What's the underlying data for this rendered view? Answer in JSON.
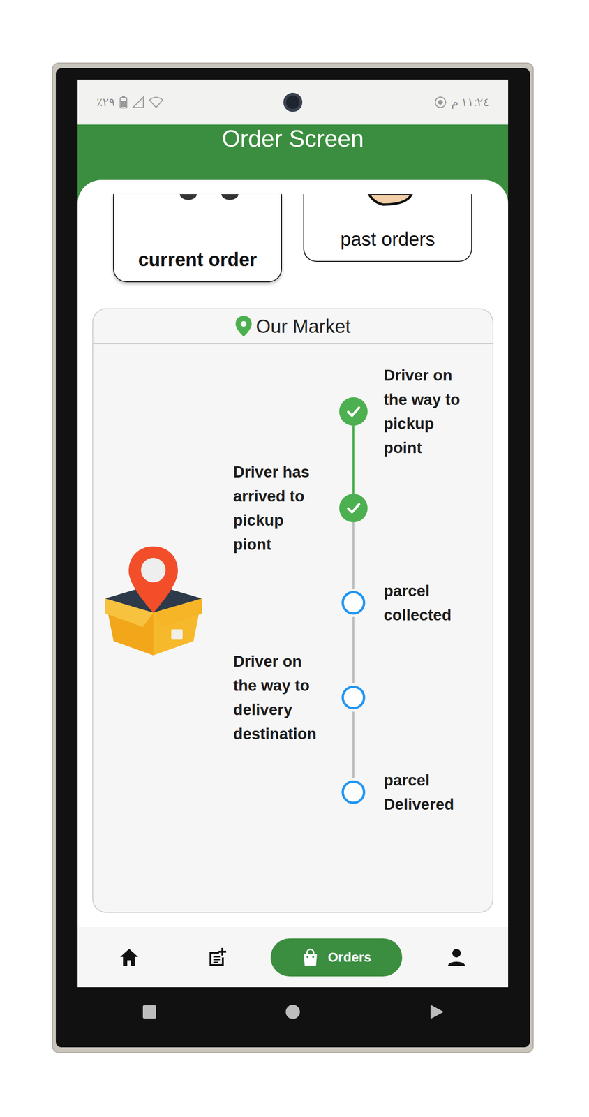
{
  "status_bar": {
    "left": "٢٩٪",
    "right": "١١:٢٤ م"
  },
  "header": {
    "title": "Order Screen"
  },
  "order_tabs": [
    {
      "label": "current order",
      "selected": true
    },
    {
      "label": "past orders",
      "selected": false
    }
  ],
  "market": {
    "title": "Our Market"
  },
  "steps": [
    {
      "label": "Driver on the way to pickup point",
      "done": true
    },
    {
      "label": "Driver has arrived to pickup piont",
      "done": true
    },
    {
      "label": "parcel collected",
      "done": false
    },
    {
      "label": "Driver on the way to delivery destination",
      "done": false
    },
    {
      "label": "parcel Delivered",
      "done": false
    }
  ],
  "bottom_nav": [
    {
      "selected": false
    },
    {
      "selected": false
    },
    {
      "label": "Orders",
      "selected": true
    },
    {
      "selected": false
    }
  ]
}
